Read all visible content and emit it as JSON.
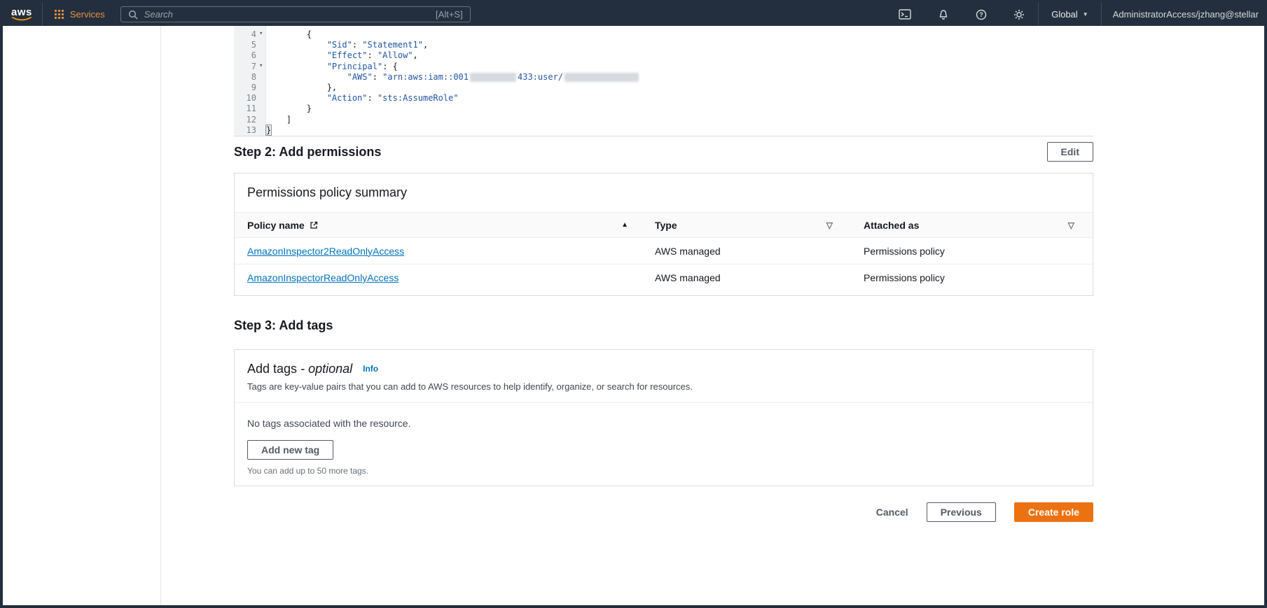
{
  "topnav": {
    "logo_text": "aws",
    "services_label": "Services",
    "search_placeholder": "Search",
    "search_shortcut": "[Alt+S]",
    "region_label": "Global",
    "region_caret": "▼",
    "account_label": "AdministratorAccess/jzhang@stellar"
  },
  "editor": {
    "lines": [
      {
        "num": "4",
        "fold": "▾",
        "pre": "        {"
      },
      {
        "num": "5",
        "fold": "",
        "pre": "            ",
        "key": "\"Sid\"",
        "sep": ": ",
        "val": "\"Statement1\"",
        "post": ","
      },
      {
        "num": "6",
        "fold": "",
        "pre": "            ",
        "key": "\"Effect\"",
        "sep": ": ",
        "val": "\"Allow\"",
        "post": ","
      },
      {
        "num": "7",
        "fold": "▾",
        "pre": "            ",
        "key": "\"Principal\"",
        "sep": ": ",
        "post": "{"
      },
      {
        "num": "8",
        "fold": "",
        "pre": "                ",
        "key": "\"AWS\"",
        "sep": ": ",
        "val": "\"arn:aws:iam::001",
        "val2": "433:user/"
      },
      {
        "num": "9",
        "fold": "",
        "pre": "            },"
      },
      {
        "num": "10",
        "fold": "",
        "pre": "            ",
        "key": "\"Action\"",
        "sep": ": ",
        "val": "\"sts:AssumeRole\""
      },
      {
        "num": "11",
        "fold": "",
        "pre": "        }"
      },
      {
        "num": "12",
        "fold": "",
        "pre": "    ]"
      },
      {
        "num": "13",
        "fold": "",
        "pre": "}"
      }
    ]
  },
  "step2": {
    "title": "Step 2: Add permissions",
    "edit_label": "Edit"
  },
  "perm_card": {
    "title": "Permissions policy summary",
    "columns": {
      "name": "Policy name",
      "type": "Type",
      "attached": "Attached as"
    },
    "icons": {
      "sort_asc": "▲",
      "filter": "▽"
    },
    "rows": [
      {
        "name": "AmazonInspector2ReadOnlyAccess",
        "type": "AWS managed",
        "attached": "Permissions policy"
      },
      {
        "name": "AmazonInspectorReadOnlyAccess",
        "type": "AWS managed",
        "attached": "Permissions policy"
      }
    ]
  },
  "step3": {
    "title": "Step 3: Add tags"
  },
  "tags_card": {
    "title": "Add tags",
    "dash": " - ",
    "optional": "optional",
    "info": "Info",
    "description": "Tags are key-value pairs that you can add to AWS resources to help identify, organize, or search for resources.",
    "empty": "No tags associated with the resource.",
    "add_button": "Add new tag",
    "limit": "You can add up to 50 more tags."
  },
  "footer": {
    "cancel": "Cancel",
    "previous": "Previous",
    "create": "Create role"
  }
}
